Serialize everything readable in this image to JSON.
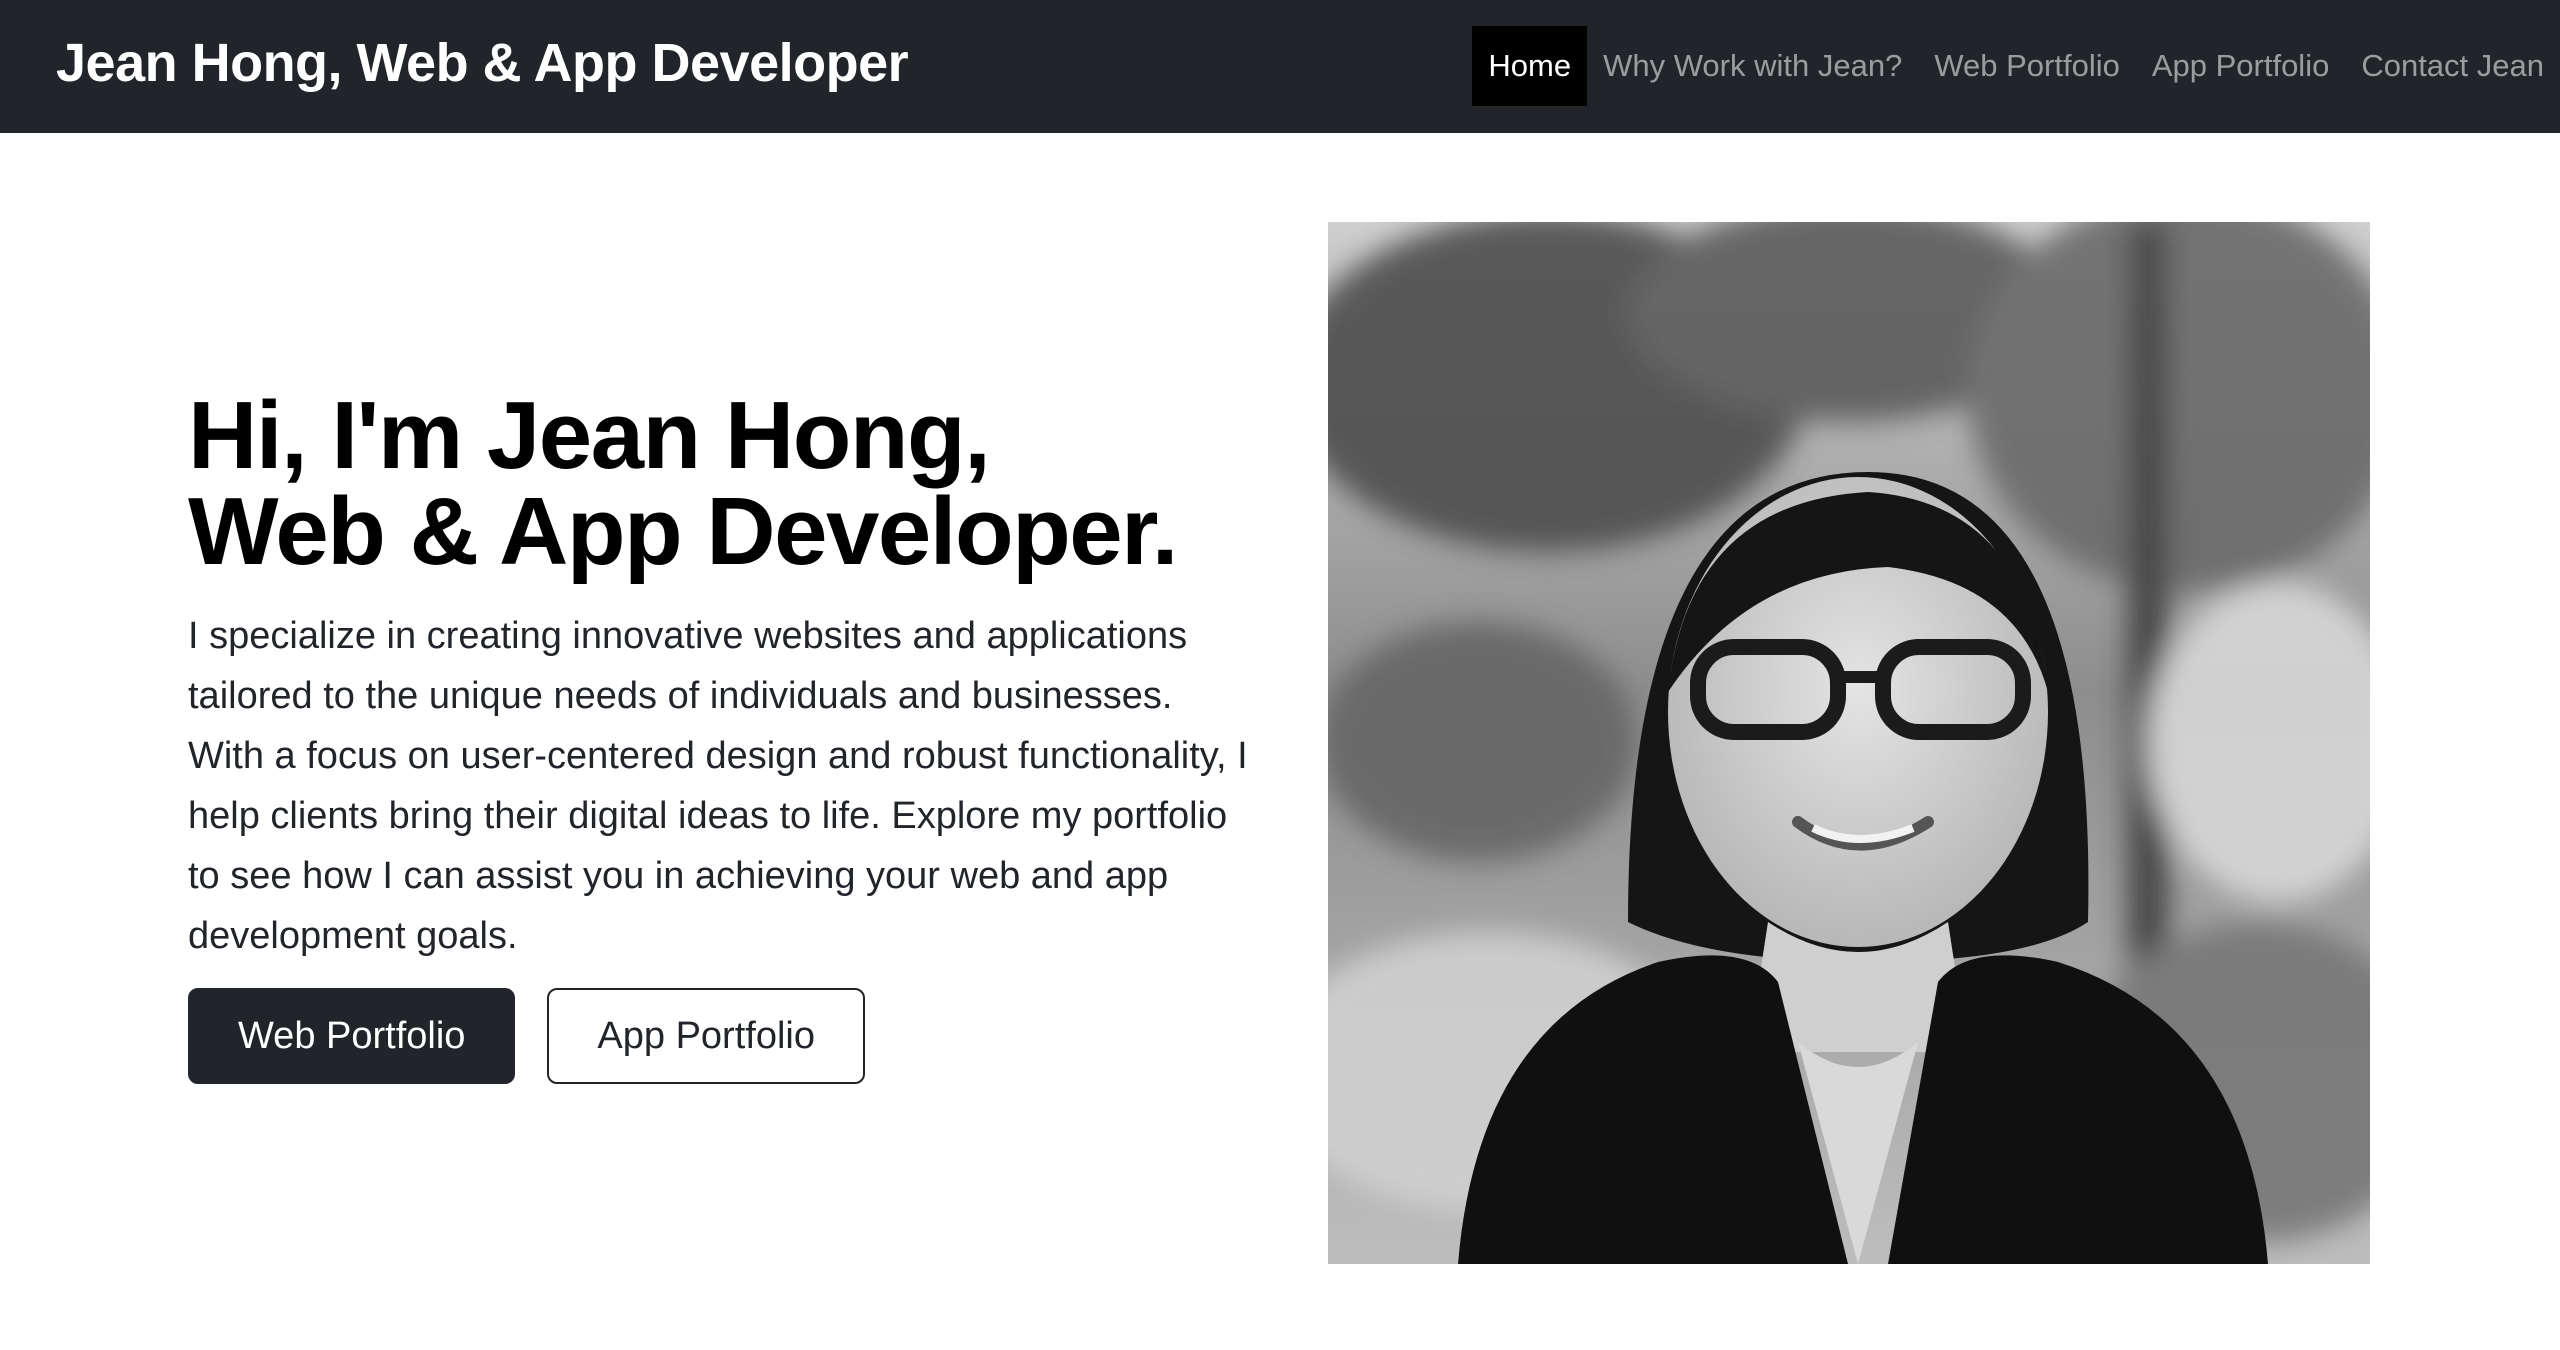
{
  "navbar": {
    "brand": "Jean Hong, Web & App Developer",
    "links": [
      {
        "label": "Home",
        "active": true
      },
      {
        "label": "Why Work with Jean?",
        "active": false
      },
      {
        "label": "Web Portfolio",
        "active": false
      },
      {
        "label": "App Portfolio",
        "active": false
      },
      {
        "label": "Contact Jean",
        "active": false
      }
    ]
  },
  "hero": {
    "title_line1": "Hi, I'm Jean Hong,",
    "title_line2": "Web & App Developer.",
    "lead": "I specialize in creating innovative websites and applications tailored to the unique needs of individuals and businesses. With a focus on user-centered design and robust functionality, I help clients bring their digital ideas to life. Explore my portfolio to see how I can assist you in achieving your web and app development goals.",
    "primary_button": "Web Portfolio",
    "secondary_button": "App Portfolio",
    "photo_icon": "portrait-photo"
  },
  "colors": {
    "navbar_bg": "#212529",
    "active_link_bg": "#000000",
    "text_dark": "#212529",
    "page_bg": "#ffffff"
  }
}
